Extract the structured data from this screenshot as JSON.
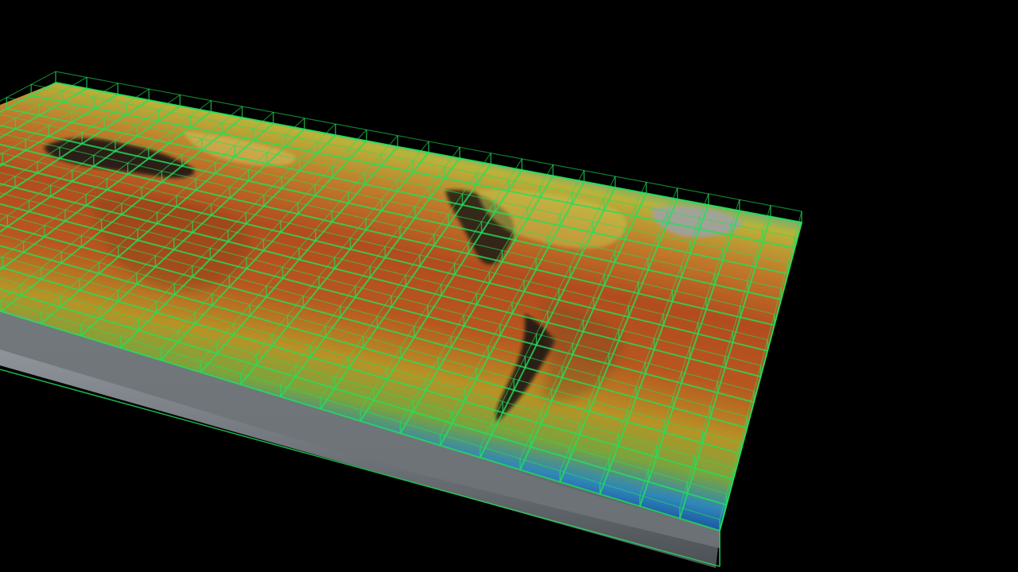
{
  "viewport": {
    "background": "#000000",
    "description_label": ""
  },
  "colors": {
    "grid": "#22e05a",
    "grid_dim": "#11a040",
    "warm": "#b8461c",
    "mid": "#c8a828",
    "cool": "#2d6fbf",
    "cold": "#0f2f8a",
    "ice": "#8a8f96",
    "land_dark": "#1e1c18",
    "cloud": "#a8aab0"
  },
  "grid": {
    "columns": 24,
    "rows": 12
  }
}
